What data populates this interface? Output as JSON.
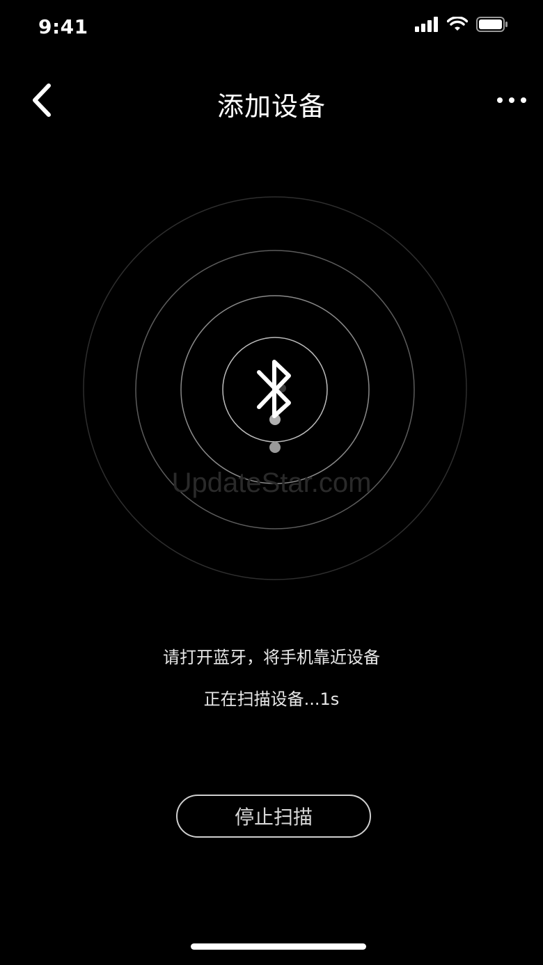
{
  "status_bar": {
    "time": "9:41",
    "icons": [
      "cellular-signal-icon",
      "wifi-icon",
      "battery-icon"
    ]
  },
  "nav": {
    "title": "添加设备",
    "back_icon": "chevron-left-icon",
    "more_icon": "more-horizontal-icon"
  },
  "scan": {
    "icon": "bluetooth-icon",
    "watermark": "UpdateStar.com",
    "instruction": "请打开蓝牙，将手机靠近设备",
    "status": "正在扫描设备...1s"
  },
  "actions": {
    "stop_label": "停止扫描"
  },
  "colors": {
    "background": "#000000",
    "foreground": "#ffffff",
    "ring_inner": "#bdbdbd",
    "ring_outer": "#2e2e2e"
  }
}
